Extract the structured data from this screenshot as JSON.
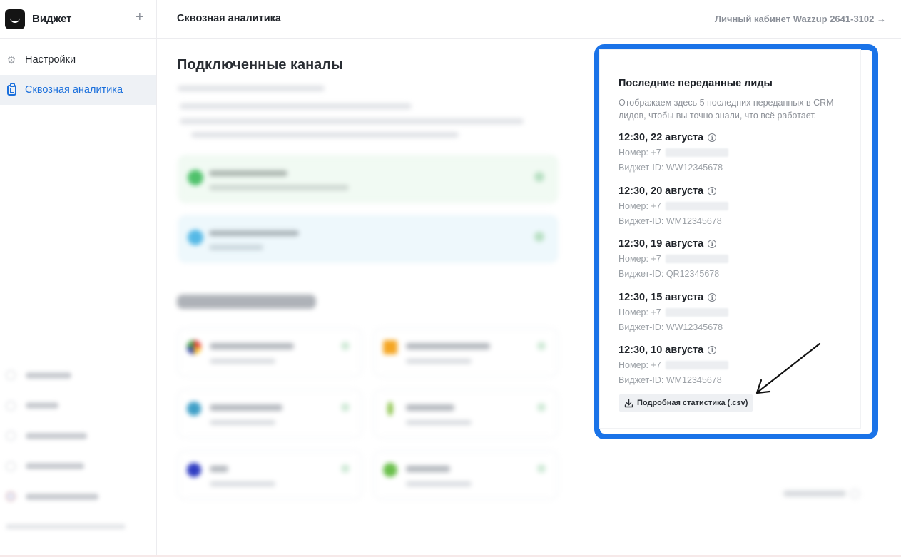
{
  "sidebar": {
    "title": "Виджет",
    "add_icon": "plus-icon",
    "items": [
      {
        "label": "Настройки",
        "icon": "gear-icon"
      },
      {
        "label": "Сквозная аналитика",
        "icon": "clipboard-chart-icon",
        "active": true
      }
    ]
  },
  "header": {
    "page_title": "Сквозная аналитика",
    "account_link": "Личный кабинет Wazzup 2641-3102 →"
  },
  "main": {
    "channels_title": "Подключенные каналы"
  },
  "leads_panel": {
    "title": "Последние переданные лиды",
    "description": "Отображаем здесь 5 последних переданных в CRM лидов, чтобы вы точно знали, что всё работает.",
    "leads": [
      {
        "time": "12:30, 22 августа",
        "phone_label": "Номер: +7",
        "widget_id": "Виджет-ID: WW12345678"
      },
      {
        "time": "12:30, 20 августа",
        "phone_label": "Номер: +7",
        "widget_id": "Виджет-ID: WM12345678"
      },
      {
        "time": "12:30, 19 августа",
        "phone_label": "Номер: +7",
        "widget_id": "Виджет-ID: QR12345678"
      },
      {
        "time": "12:30, 15 августа",
        "phone_label": "Номер: +7",
        "widget_id": "Виджет-ID: WW12345678"
      },
      {
        "time": "12:30, 10 августа",
        "phone_label": "Номер: +7",
        "widget_id": "Виджет-ID: WM12345678"
      }
    ],
    "csv_button": "Подробная статистика (.csv)"
  },
  "colors": {
    "accent": "#1a6fdc",
    "highlight_frame": "#1a73e8",
    "active_nav_bg": "#eef1f5"
  }
}
